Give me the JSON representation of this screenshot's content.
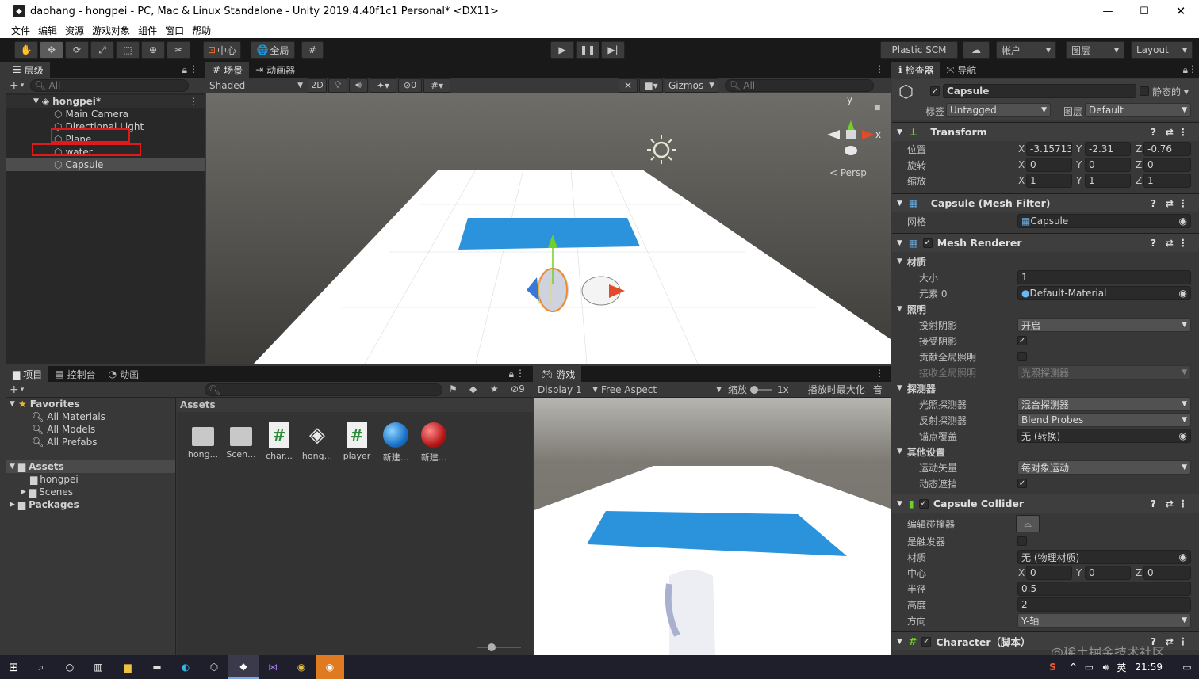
{
  "window": {
    "title": "daohang - hongpei - PC, Mac & Linux Standalone - Unity 2019.4.40f1c1 Personal* <DX11>"
  },
  "menu": [
    "文件",
    "编辑",
    "资源",
    "游戏对象",
    "组件",
    "窗口",
    "帮助"
  ],
  "toolbar": {
    "pivot": "中心",
    "global": "全局",
    "plastic": "Plastic SCM",
    "account": "帐户",
    "layers": "图层",
    "layout": "Layout"
  },
  "hierarchy": {
    "tab": "层级",
    "search": "All",
    "scene": "hongpei*",
    "items": [
      "Main Camera",
      "Directional Light",
      "Plane",
      "water",
      "Capsule"
    ]
  },
  "scene": {
    "tab_scene": "场景",
    "tab_animator": "动画器",
    "shading": "Shaded",
    "mode2d": "2D",
    "hidden_count": "0",
    "gizmos": "Gizmos",
    "search": "All",
    "persp": "< Persp",
    "axis_y": "y",
    "axis_x": "x"
  },
  "project": {
    "tabs": [
      "项目",
      "控制台",
      "动画"
    ],
    "favorites_label": "Favorites",
    "favorites": [
      "All Materials",
      "All Models",
      "All Prefabs"
    ],
    "assets_label": "Assets",
    "asset_folders": [
      "hongpei",
      "Scenes"
    ],
    "packages": "Packages",
    "breadcrumb": "Assets",
    "hidden_count": "9",
    "items": [
      "hong...",
      "Scen...",
      "char...",
      "hong...",
      "player",
      "新建...",
      "新建..."
    ]
  },
  "game": {
    "tab": "游戏",
    "display": "Display 1",
    "aspect": "Free Aspect",
    "scale_label": "缩放",
    "scale": "1x",
    "maximize": "播放时最大化",
    "cut": "音"
  },
  "inspector": {
    "tabs": [
      "检查器",
      "导航"
    ],
    "name": "Capsule",
    "static": "静态的",
    "tag_label": "标签",
    "tag": "Untagged",
    "layer_label": "图层",
    "layer": "Default",
    "transform": {
      "title": "Transform",
      "rows": [
        {
          "label": "位置",
          "x": "-3.15713",
          "y": "-2.31",
          "z": "-0.76"
        },
        {
          "label": "旋转",
          "x": "0",
          "y": "0",
          "z": "0"
        },
        {
          "label": "缩放",
          "x": "1",
          "y": "1",
          "z": "1"
        }
      ]
    },
    "mesh_filter": {
      "title": "Capsule (Mesh Filter)",
      "mesh_label": "网格",
      "mesh": "Capsule"
    },
    "mesh_renderer": {
      "title": "Mesh Renderer",
      "materials": "材质",
      "size_label": "大小",
      "size": "1",
      "element_label": "元素 0",
      "element": "Default-Material",
      "lighting": "照明",
      "cast_label": "投射阴影",
      "cast": "开启",
      "receive_label": "接受阴影",
      "contribute_label": "贡献全局照明",
      "receive_gi_label": "接收全局照明",
      "receive_gi": "光照探测器",
      "probes": "探测器",
      "light_probes_label": "光照探测器",
      "light_probes": "混合探测器",
      "reflection_label": "反射探测器",
      "reflection": "Blend Probes",
      "anchor_label": "锚点覆盖",
      "anchor": "无 (转换)",
      "other": "其他设置",
      "motion_label": "运动矢量",
      "motion": "每对象运动",
      "dynamic_label": "动态遮挡"
    },
    "collider": {
      "title": "Capsule Collider",
      "edit_label": "编辑碰撞器",
      "trigger_label": "是触发器",
      "material_label": "材质",
      "material": "无 (物理材质)",
      "center_label": "中心",
      "cx": "0",
      "cy": "0",
      "cz": "0",
      "radius_label": "半径",
      "radius": "0.5",
      "height_label": "高度",
      "height": "2",
      "direction_label": "方向",
      "direction": "Y-轴"
    },
    "script": {
      "title": "Character（脚本）"
    }
  },
  "watermark": "@稀土掘金技术社区",
  "taskbar": {
    "time": "21:59"
  }
}
